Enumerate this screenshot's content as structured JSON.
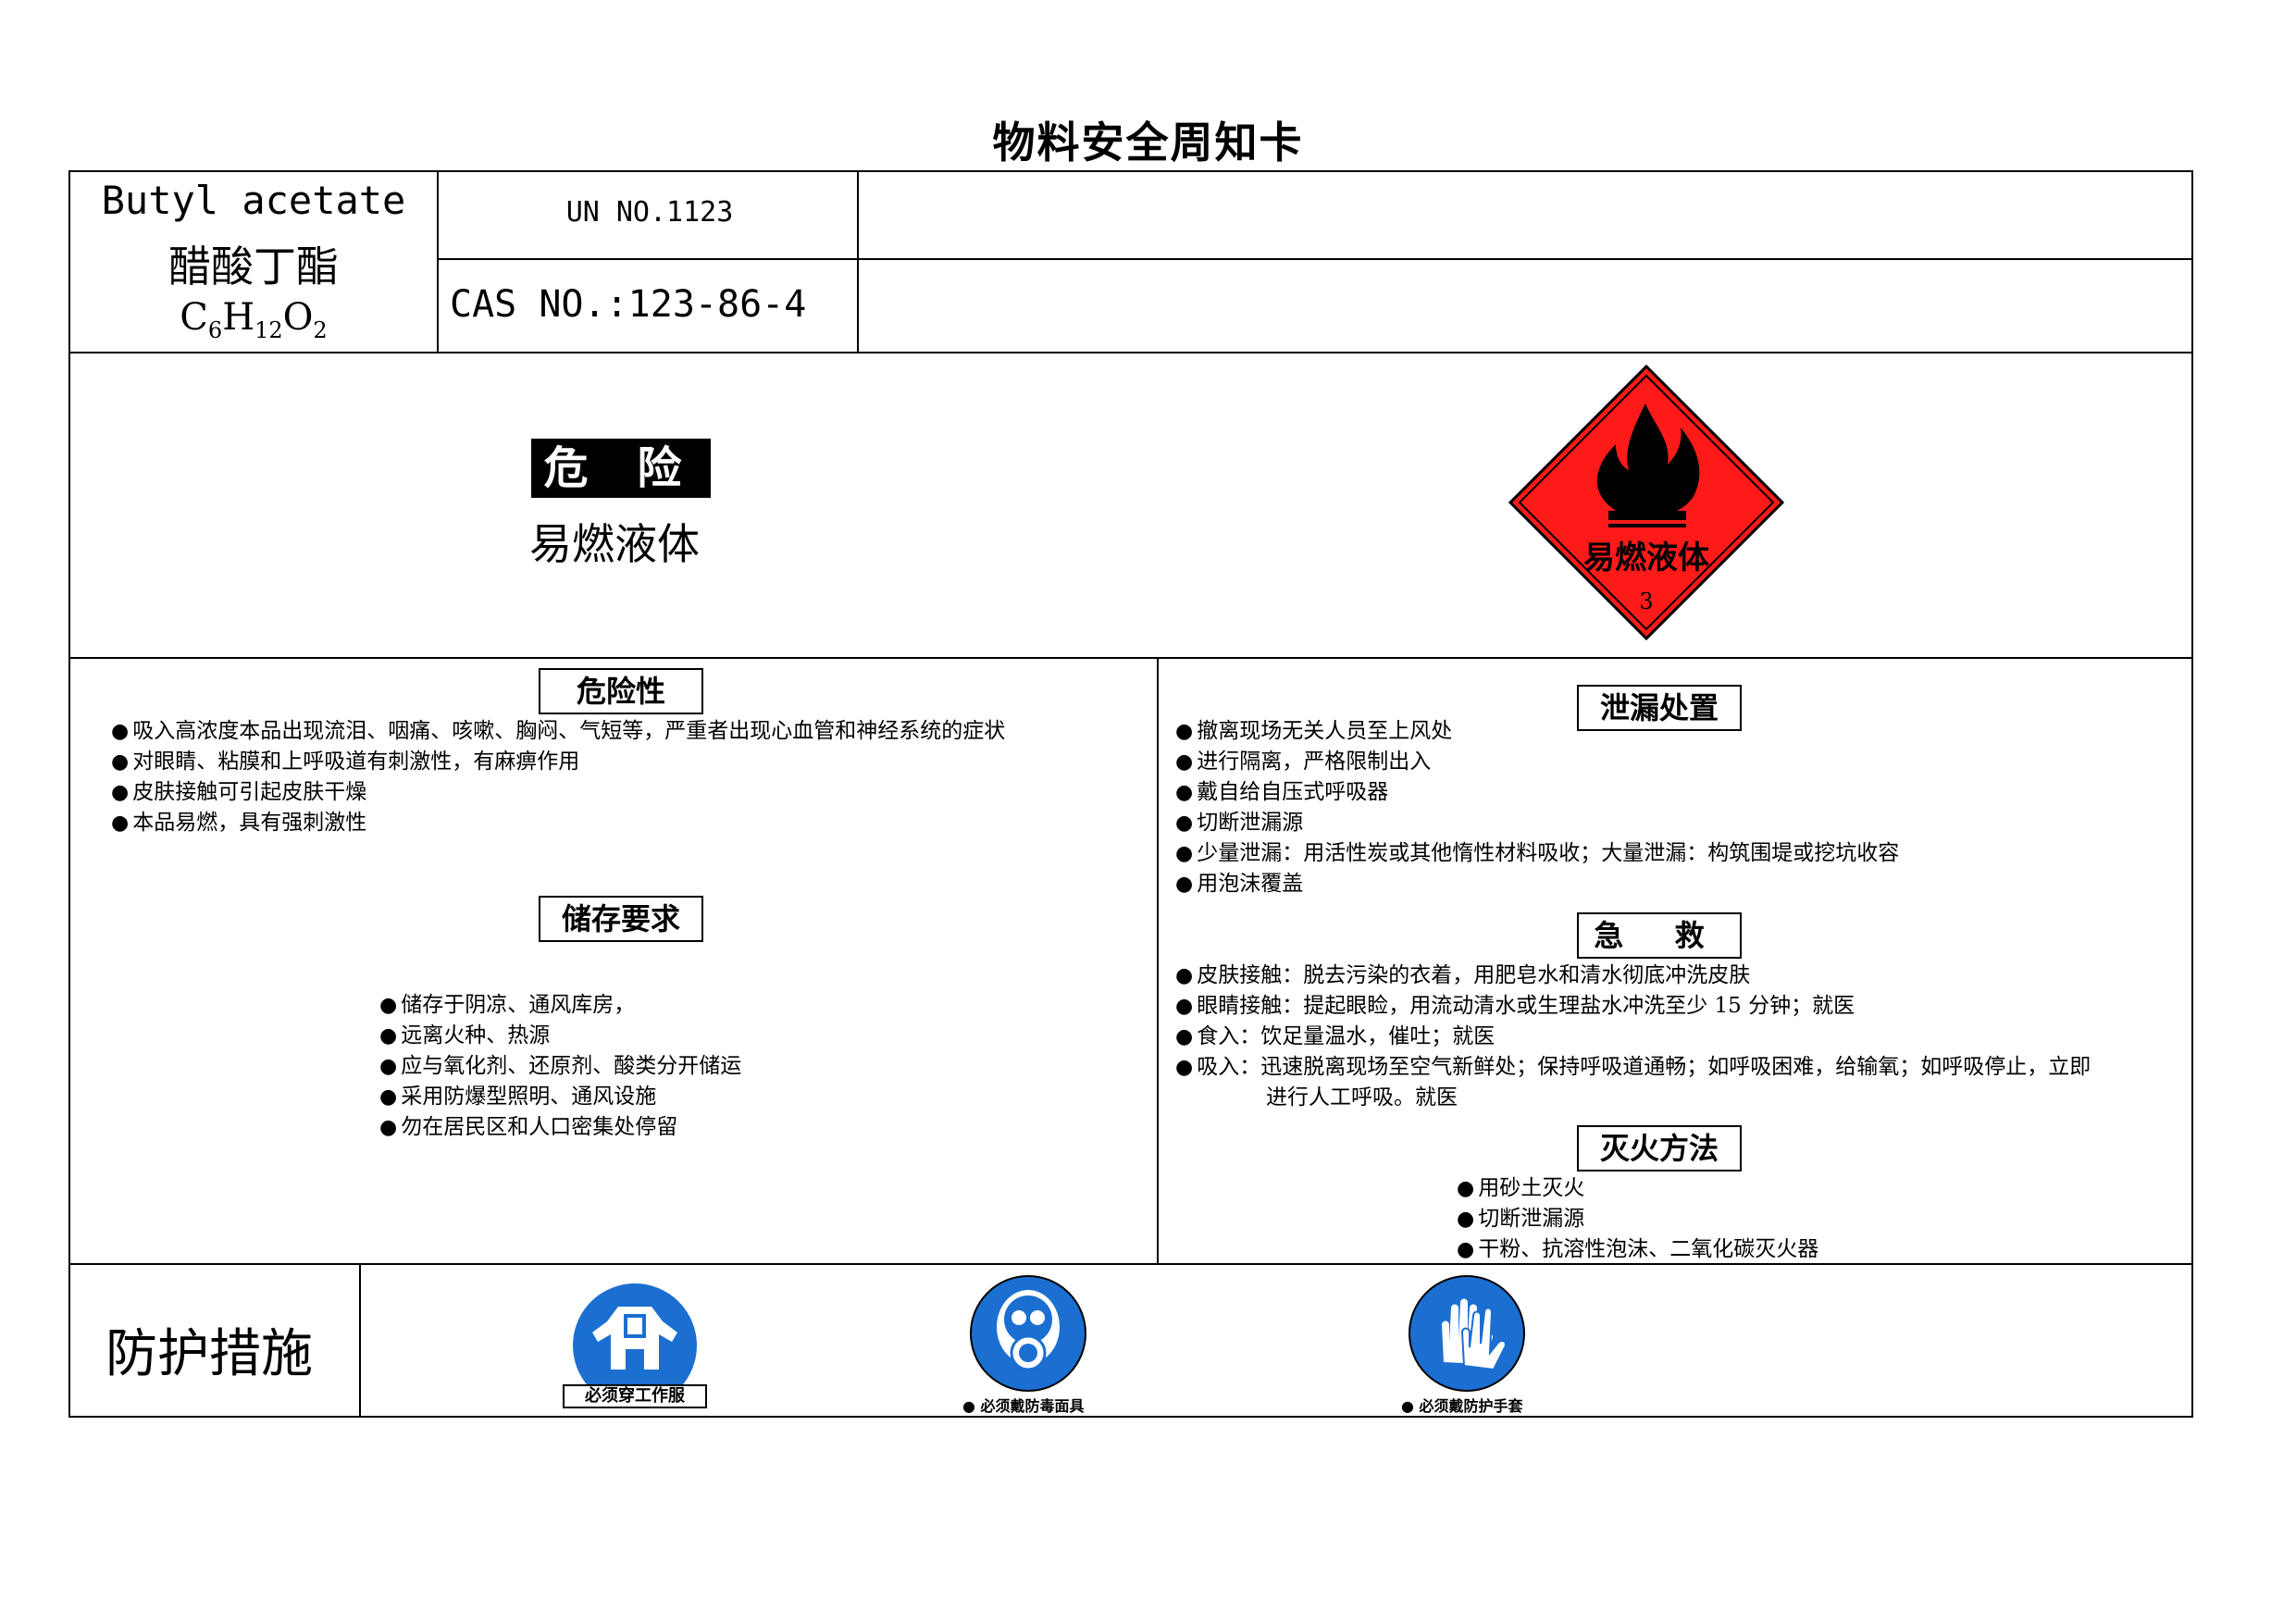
{
  "card_title": "物料安全周知卡",
  "substance": {
    "name_en": "Butyl acetate",
    "name_cn": "醋酸丁酯",
    "formula": {
      "c": "C",
      "c_n": "6",
      "h": "H",
      "h_n": "12",
      "o": "O",
      "o_n": "2"
    },
    "un_no": "UN NO.1123",
    "cas_no": "CAS NO.:123-86-4"
  },
  "hazard": {
    "signal_word": "危 险",
    "category": "易燃液体",
    "placard_text": "易燃液体",
    "placard_class": "3",
    "placard_color": "#ff1a1a"
  },
  "sections": {
    "hazards": {
      "title": "危险性",
      "items": [
        "吸入高浓度本品出现流泪、咽痛、咳嗽、胸闷、气短等，严重者出现心血管和神经系统的症状",
        "对眼睛、粘膜和上呼吸道有刺激性，有麻痹作用",
        "皮肤接触可引起皮肤干燥",
        "本品易燃，具有强刺激性"
      ]
    },
    "storage": {
      "title": "储存要求",
      "items": [
        "储存于阴凉、通风库房，",
        "远离火种、热源",
        "应与氧化剂、还原剂、酸类分开储运",
        "采用防爆型照明、通风设施",
        "勿在居民区和人口密集处停留"
      ]
    },
    "leak": {
      "title": "泄漏处置",
      "items": [
        "撤离现场无关人员至上风处",
        "进行隔离，严格限制出入",
        "戴自给自压式呼吸器",
        "切断泄漏源",
        "少量泄漏：用活性炭或其他惰性材料吸收；大量泄漏：构筑围堤或挖坑收容",
        "用泡沫覆盖"
      ]
    },
    "first_aid": {
      "title": "急 救",
      "items": [
        "皮肤接触：脱去污染的衣着，用肥皂水和清水彻底冲洗皮肤",
        "眼睛接触：提起眼睑，用流动清水或生理盐水冲洗至少 15 分钟；就医",
        "食入：饮足量温水，催吐；就医",
        "吸入：迅速脱离现场至空气新鲜处；保持呼吸道通畅；如呼吸困难，给输氧；如呼吸停止，立即"
      ],
      "continuation": "进行人工呼吸。就医"
    },
    "fire": {
      "title": "灭火方法",
      "items": [
        "用砂土灭火",
        "切断泄漏源",
        "干粉、抗溶性泡沫、二氧化碳灭火器"
      ]
    }
  },
  "protection": {
    "title": "防护措施",
    "signs": [
      {
        "label": "必须穿工作服",
        "icon": "work-clothes-icon"
      },
      {
        "label": "必须戴防毒面具",
        "icon": "gas-mask-icon"
      },
      {
        "label": "必须戴防护手套",
        "icon": "gloves-icon"
      }
    ],
    "sign_color": "#1a6fd1"
  }
}
